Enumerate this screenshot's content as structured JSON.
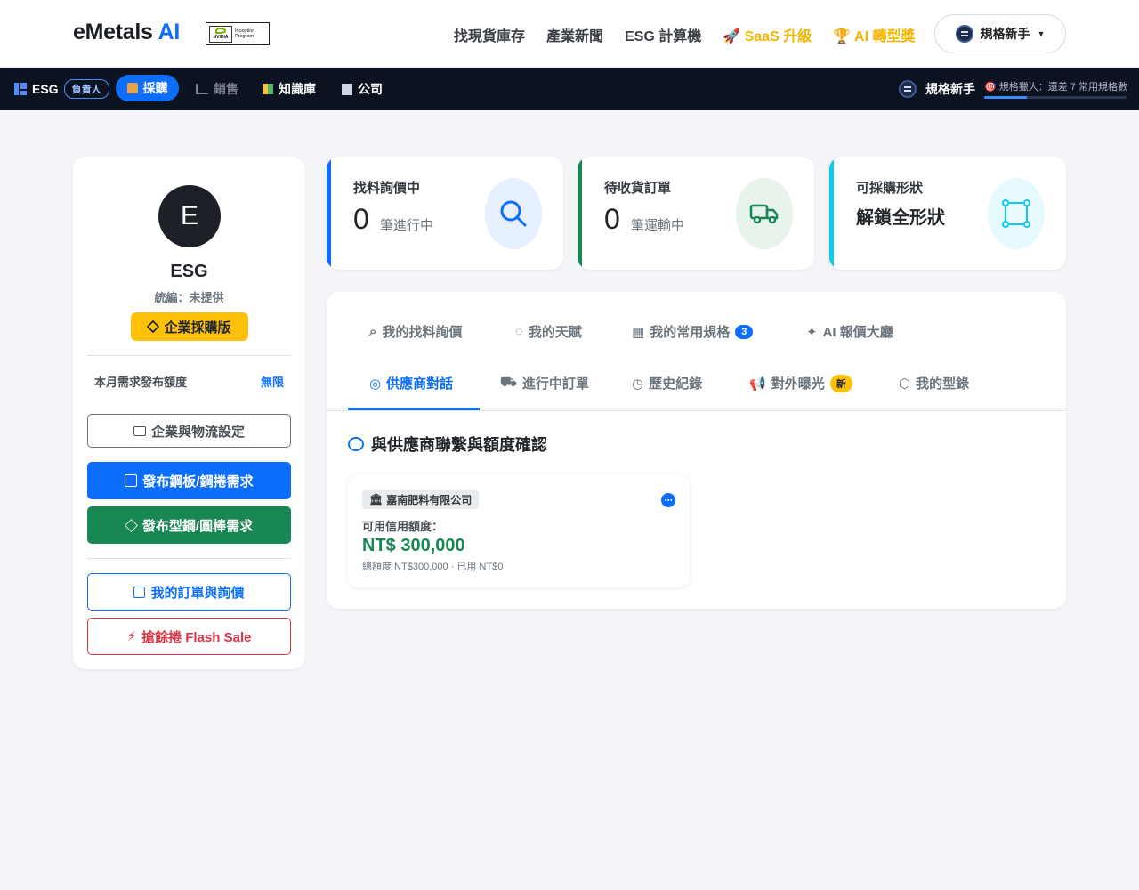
{
  "brand": {
    "name": "eMetals",
    "ai": "AI",
    "partner_line1": "Inception",
    "partner_line2": "Program",
    "partner_logo": "NVIDIA"
  },
  "nav": {
    "links": [
      "找現貨庫存",
      "產業新聞",
      "ESG 計算機",
      "SaaS 升級",
      "AI 轉型獎"
    ],
    "user": "規格新手"
  },
  "subnav": {
    "org": "ESG",
    "role": "負責人",
    "active": "採購",
    "sales": "銷售",
    "knowledge": "知識庫",
    "company": "公司",
    "level": "規格新手",
    "progress_text": "規格獵人：還差 7 常用規格數",
    "progress_value": 0.3
  },
  "profile": {
    "initial": "E",
    "company": "ESG",
    "tax_id": "統編：未提供",
    "plan": "企業採購版",
    "quota_label": "本月需求發布額度",
    "quota_value": "無限",
    "btn_settings": "企業與物流設定",
    "btn_plate": "發布鋼板/鋼捲需求",
    "btn_section": "發布型鋼/圓棒需求",
    "btn_orders": "我的訂單與詢價",
    "btn_flash": "搶餘捲 Flash Sale"
  },
  "stats": [
    {
      "title": "找料詢價中",
      "value": "0",
      "unit": "筆進行中",
      "color": "#0d6efd"
    },
    {
      "title": "待收貨訂單",
      "value": "0",
      "unit": "筆運輸中",
      "color": "#198754"
    },
    {
      "title": "可採購形狀",
      "value": "解鎖全形狀",
      "color": "#0dcaf0"
    }
  ],
  "tabs": {
    "row1": [
      "我的找料詢價",
      "我的天賦",
      "我的常用規格",
      "AI 報價大廳"
    ],
    "spec_count": "3",
    "row2": [
      "供應商對話",
      "進行中訂單",
      "歷史紀錄",
      "對外曝光",
      "我的型錄"
    ],
    "new_badge": "新"
  },
  "section": {
    "title": "與供應商聯繫與額度確認"
  },
  "supplier": {
    "name": "嘉南肥料有限公司",
    "credit_label": "可用信用額度：",
    "amount": "NT$ 300,000",
    "detail": "總額度 NT$300,000 · 已用 NT$0"
  }
}
